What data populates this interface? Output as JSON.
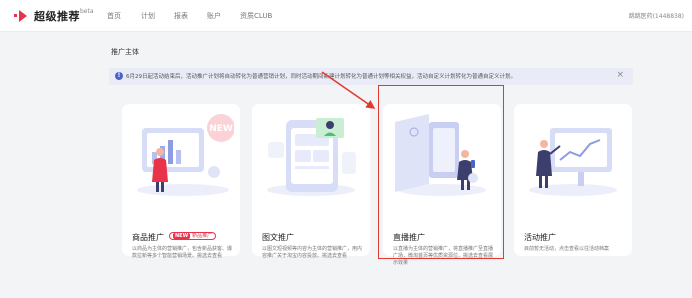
{
  "header": {
    "logo_text": "超级推荐",
    "beta": "beta",
    "nav": [
      "首页",
      "计划",
      "报表",
      "账户",
      "资质CLUB"
    ],
    "user": "跳跳医药(1448838)"
  },
  "main": {
    "section_title": "推广主体",
    "notice": "6月29日起活动结束后，活动推广计划将自动转化为普通营销计划，同时活动期间新建计划转化为普通计划等相关权益，活动自定义计划转化为普通自定义计划。",
    "close": "×"
  },
  "cards": [
    {
      "title": "商品推广",
      "badge_new": "NEW",
      "badge_text": "新品推广",
      "desc": "以商品为主体的营销推广，包含新品获客、爆款拉新等多个智能营销场景。挑选去查看"
    },
    {
      "title": "图文推广",
      "desc": "以图文短视频等内容为主体的营销推广，用内容推广关于淘宝内容投放。挑选去查看"
    },
    {
      "title": "直播推广",
      "desc": "以直播为主体的营销推广，将直播推广至直播广场，微淘首页等优质资源位。挑选去查看展示效果"
    },
    {
      "title": "活动推广",
      "desc": "目前暂无活动，点击查看以往活动档案"
    }
  ]
}
